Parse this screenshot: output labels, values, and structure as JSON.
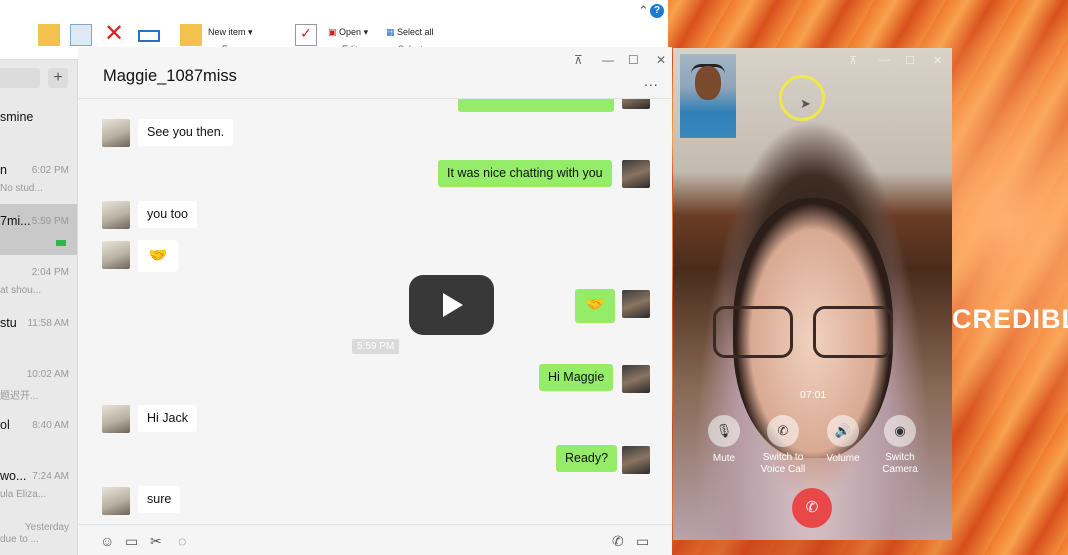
{
  "desktop": {
    "wallpaper_text": "CREDIBLE"
  },
  "explorer": {
    "ribbon": {
      "new_item": "New item",
      "easy_access": "Easy access",
      "open": "Open",
      "edit": "Edit",
      "select_all": "Select all",
      "select_none": "Select none"
    },
    "help": "?"
  },
  "sidebar": {
    "plus": "+",
    "items": [
      {
        "name": "smine",
        "time": "",
        "preview": ""
      },
      {
        "name": "n",
        "time": "6:02 PM",
        "preview": "No stud..."
      },
      {
        "name": "7mi...",
        "time": "5:59 PM",
        "preview": ""
      },
      {
        "name": "",
        "time": "2:04 PM",
        "preview": "at shou..."
      },
      {
        "name": "stu",
        "time": "11:58 AM",
        "preview": ""
      },
      {
        "name": "",
        "time": "10:02 AM",
        "preview": "题迟开..."
      },
      {
        "name": "ol",
        "time": "8:40 AM",
        "preview": ""
      },
      {
        "name": "wo...",
        "time": "7:24 AM",
        "preview": "ula Eliza..."
      },
      {
        "name": "",
        "time": "Yesterday",
        "preview": "due to ..."
      }
    ]
  },
  "chat": {
    "title": "Maggie_1087miss",
    "more": "...",
    "time_separator": "5:59 PM",
    "messages": [
      {
        "from": "her",
        "text": "See you then."
      },
      {
        "from": "me",
        "text": "It was nice chatting with you"
      },
      {
        "from": "her",
        "text": "you too"
      },
      {
        "from": "her",
        "text": "🤝"
      },
      {
        "from": "me",
        "text": "🤝"
      },
      {
        "from": "me",
        "text": "Hi Maggie"
      },
      {
        "from": "her",
        "text": "Hi Jack"
      },
      {
        "from": "me",
        "text": "Ready?"
      },
      {
        "from": "her",
        "text": "sure"
      }
    ]
  },
  "call": {
    "timer": "07:01",
    "buttons": {
      "mute": "Mute",
      "switch_voice_1": "Switch to",
      "switch_voice_2": "Voice Call",
      "volume": "Volume",
      "switch_camera_1": "Switch",
      "switch_camera_2": "Camera"
    }
  }
}
